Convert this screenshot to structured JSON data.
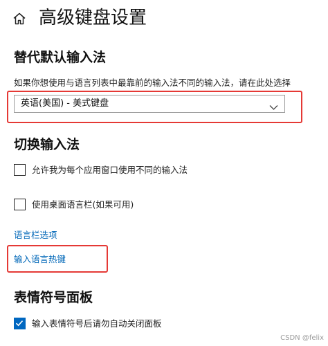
{
  "header": {
    "title": "高级键盘设置",
    "home_icon": "home-icon"
  },
  "default_input": {
    "heading": "替代默认输入法",
    "description": "如果你想使用与语言列表中最靠前的输入法不同的输入法，请在此处选择",
    "selected_value": "英语(美国) - 美式键盘",
    "dropdown_icon": "chevron-down-icon"
  },
  "switch_input": {
    "heading": "切换输入法",
    "checkboxes": [
      {
        "label": "允许我为每个应用窗口使用不同的输入法",
        "checked": false
      },
      {
        "label": "使用桌面语言栏(如果可用)",
        "checked": false
      }
    ],
    "links": [
      "语言栏选项",
      "输入语言热键"
    ]
  },
  "emoji_panel": {
    "heading": "表情符号面板",
    "checkboxes": [
      {
        "label": "输入表情符号后请勿自动关闭面板",
        "checked": true
      }
    ]
  },
  "annotations": {
    "highlight_color": "#e53935"
  },
  "colors": {
    "accent": "#0067c0",
    "link": "#0067b8"
  },
  "watermark": "CSDN @felix"
}
